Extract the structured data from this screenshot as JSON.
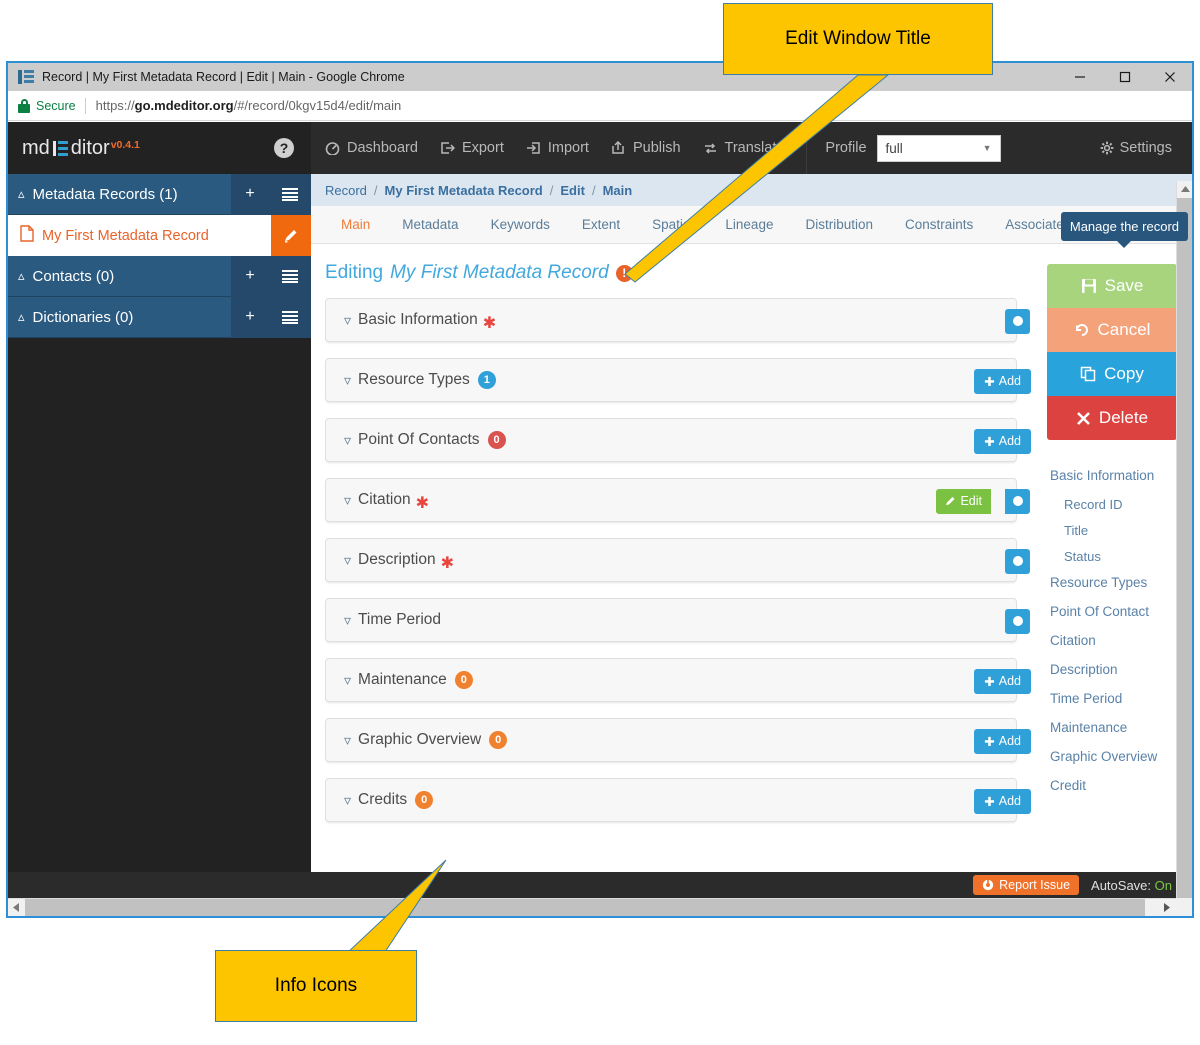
{
  "browser": {
    "window_title": "Record | My First Metadata Record | Edit | Main - Google Chrome",
    "secure_label": "Secure",
    "url_prefix": "https://",
    "url_domain": "go.mdeditor.org",
    "url_path": "/#/record/0kgv15d4/edit/main",
    "minimize_label": "Minimize",
    "maximize_label": "Maximize",
    "close_label": "Close"
  },
  "brand": {
    "text_pre": "md",
    "text_post": "ditor",
    "version": "v0.4.1",
    "help_glyph": "?"
  },
  "sidebar": {
    "groups": [
      {
        "title": "Metadata Records (1)",
        "add_label": "+",
        "list_label": "list"
      },
      {
        "title": "Contacts (0)",
        "add_label": "+",
        "list_label": "list"
      },
      {
        "title": "Dictionaries (0)",
        "add_label": "+",
        "list_label": "list"
      }
    ],
    "record": {
      "name": "My First Metadata Record",
      "edit_label": "edit"
    }
  },
  "topnav": {
    "items": [
      {
        "label": "Dashboard",
        "icon": "dashboard-icon"
      },
      {
        "label": "Export",
        "icon": "export-icon"
      },
      {
        "label": "Import",
        "icon": "import-icon"
      },
      {
        "label": "Publish",
        "icon": "publish-icon"
      },
      {
        "label": "Translate",
        "icon": "translate-icon"
      }
    ],
    "profile_label": "Profile",
    "profile_value": "full",
    "settings_label": "Settings"
  },
  "breadcrumb": {
    "items": [
      "Record",
      "My First Metadata Record",
      "Edit",
      "Main"
    ],
    "separator": "/"
  },
  "tabs": {
    "items": [
      "Main",
      "Metadata",
      "Keywords",
      "Extent",
      "Spatial",
      "Lineage",
      "Distribution",
      "Constraints",
      "Associated"
    ],
    "active": "Main"
  },
  "tooltip": {
    "manage_record": "Manage the record"
  },
  "editing": {
    "prefix": "Editing",
    "record_name": "My First Metadata Record",
    "warning_glyph": "!"
  },
  "panels": [
    {
      "title": "Basic Information",
      "required": true,
      "badge": null,
      "badge_color": null,
      "action": "info"
    },
    {
      "title": "Resource Types",
      "required": false,
      "badge": "1",
      "badge_color": "blue",
      "action": "add",
      "add_label": "Add"
    },
    {
      "title": "Point Of Contacts",
      "required": false,
      "badge": "0",
      "badge_color": "red",
      "action": "add",
      "add_label": "Add"
    },
    {
      "title": "Citation",
      "required": true,
      "badge": null,
      "badge_color": null,
      "action": "edit-info",
      "edit_label": "Edit"
    },
    {
      "title": "Description",
      "required": true,
      "badge": null,
      "badge_color": null,
      "action": "info"
    },
    {
      "title": "Time Period",
      "required": false,
      "badge": null,
      "badge_color": null,
      "action": "info"
    },
    {
      "title": "Maintenance",
      "required": false,
      "badge": "0",
      "badge_color": "orange",
      "action": "add",
      "add_label": "Add"
    },
    {
      "title": "Graphic Overview",
      "required": false,
      "badge": "0",
      "badge_color": "orange",
      "action": "add",
      "add_label": "Add"
    },
    {
      "title": "Credits",
      "required": false,
      "badge": "0",
      "badge_color": "orange",
      "action": "add",
      "add_label": "Add"
    }
  ],
  "manage_buttons": [
    {
      "label": "Save",
      "color": "#a8d47e",
      "icon": "save-icon"
    },
    {
      "label": "Cancel",
      "color": "#f4a27a",
      "icon": "undo-icon"
    },
    {
      "label": "Copy",
      "color": "#29a3dc",
      "icon": "copy-icon"
    },
    {
      "label": "Delete",
      "color": "#dc4340",
      "icon": "close-x-icon"
    }
  ],
  "toc": [
    {
      "label": "Basic Information",
      "sub": false
    },
    {
      "label": "Record ID",
      "sub": true
    },
    {
      "label": "Title",
      "sub": true
    },
    {
      "label": "Status",
      "sub": true
    },
    {
      "label": "Resource Types",
      "sub": false
    },
    {
      "label": "Point Of Contact",
      "sub": false
    },
    {
      "label": "Citation",
      "sub": false
    },
    {
      "label": "Description",
      "sub": false
    },
    {
      "label": "Time Period",
      "sub": false
    },
    {
      "label": "Maintenance",
      "sub": false
    },
    {
      "label": "Graphic Overview",
      "sub": false
    },
    {
      "label": "Credit",
      "sub": false
    }
  ],
  "footer": {
    "report_issue": "Report Issue",
    "autosave_label": "AutoSave:",
    "autosave_value": "On"
  },
  "callouts": [
    {
      "text": "Edit Window Title"
    },
    {
      "text": "Info Icons"
    }
  ]
}
